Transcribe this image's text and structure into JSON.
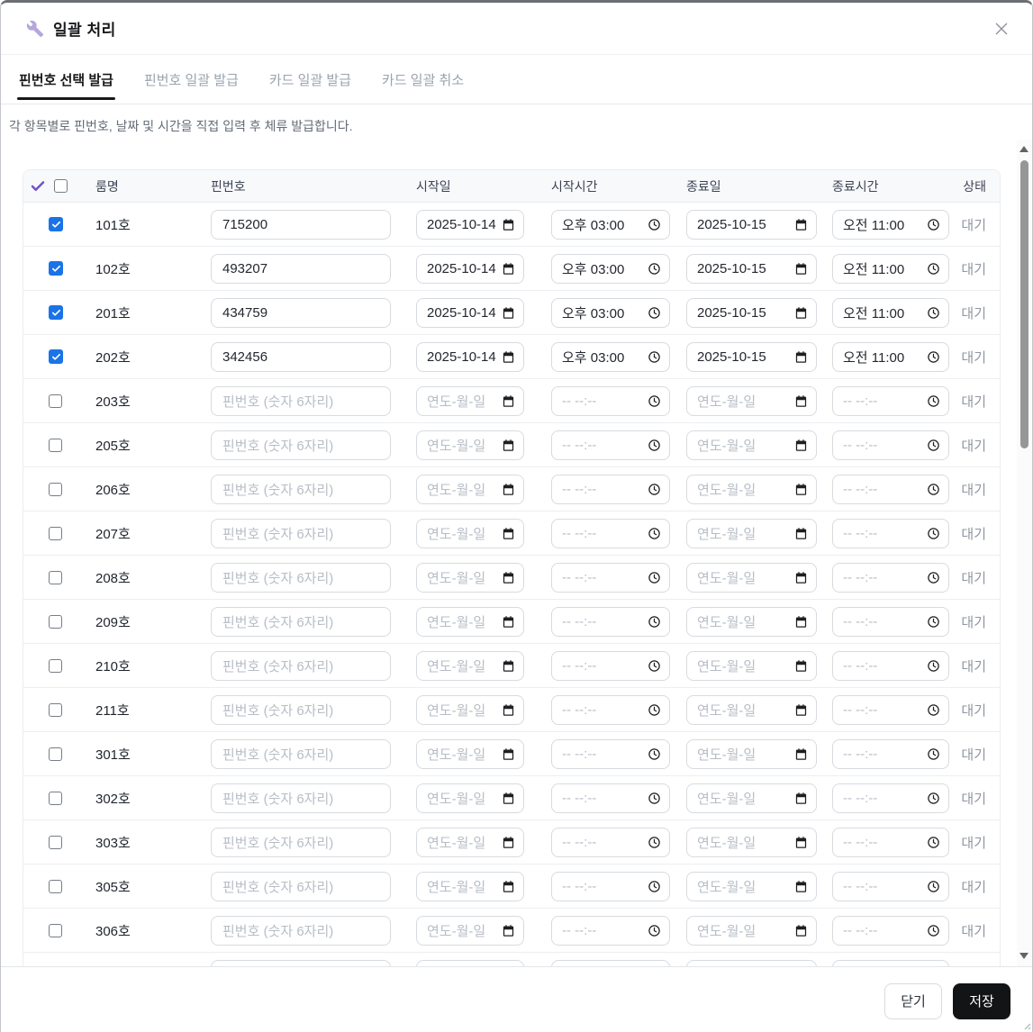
{
  "modal": {
    "title": "일괄 처리"
  },
  "tabs": [
    {
      "label": "핀번호 선택 발급",
      "active": true
    },
    {
      "label": "핀번호 일괄 발급",
      "active": false
    },
    {
      "label": "카드 일괄 발급",
      "active": false
    },
    {
      "label": "카드 일괄 취소",
      "active": false
    }
  ],
  "description": "각 항목별로 핀번호, 날짜 및 시간을 직접 입력 후 체류 발급합니다.",
  "table": {
    "columns": {
      "room": "룸명",
      "pin": "핀번호",
      "start_date": "시작일",
      "start_time": "시작시간",
      "end_date": "종료일",
      "end_time": "종료시간",
      "status": "상태"
    },
    "pin_placeholder": "핀번호 (숫자 6자리)",
    "date_placeholder": "연도-월-일",
    "time_placeholder": "-- --:--",
    "rows": [
      {
        "room": "101호",
        "checked": true,
        "pin": "715200",
        "start_date": "2025-10-14",
        "start_time": "오후 03:00",
        "end_date": "2025-10-15",
        "end_time": "오전 11:00",
        "status": "대기"
      },
      {
        "room": "102호",
        "checked": true,
        "pin": "493207",
        "start_date": "2025-10-14",
        "start_time": "오후 03:00",
        "end_date": "2025-10-15",
        "end_time": "오전 11:00",
        "status": "대기"
      },
      {
        "room": "201호",
        "checked": true,
        "pin": "434759",
        "start_date": "2025-10-14",
        "start_time": "오후 03:00",
        "end_date": "2025-10-15",
        "end_time": "오전 11:00",
        "status": "대기"
      },
      {
        "room": "202호",
        "checked": true,
        "pin": "342456",
        "start_date": "2025-10-14",
        "start_time": "오후 03:00",
        "end_date": "2025-10-15",
        "end_time": "오전 11:00",
        "status": "대기"
      },
      {
        "room": "203호",
        "checked": false,
        "pin": "",
        "start_date": "",
        "start_time": "",
        "end_date": "",
        "end_time": "",
        "status": "대기"
      },
      {
        "room": "205호",
        "checked": false,
        "pin": "",
        "start_date": "",
        "start_time": "",
        "end_date": "",
        "end_time": "",
        "status": "대기"
      },
      {
        "room": "206호",
        "checked": false,
        "pin": "",
        "start_date": "",
        "start_time": "",
        "end_date": "",
        "end_time": "",
        "status": "대기"
      },
      {
        "room": "207호",
        "checked": false,
        "pin": "",
        "start_date": "",
        "start_time": "",
        "end_date": "",
        "end_time": "",
        "status": "대기"
      },
      {
        "room": "208호",
        "checked": false,
        "pin": "",
        "start_date": "",
        "start_time": "",
        "end_date": "",
        "end_time": "",
        "status": "대기"
      },
      {
        "room": "209호",
        "checked": false,
        "pin": "",
        "start_date": "",
        "start_time": "",
        "end_date": "",
        "end_time": "",
        "status": "대기"
      },
      {
        "room": "210호",
        "checked": false,
        "pin": "",
        "start_date": "",
        "start_time": "",
        "end_date": "",
        "end_time": "",
        "status": "대기"
      },
      {
        "room": "211호",
        "checked": false,
        "pin": "",
        "start_date": "",
        "start_time": "",
        "end_date": "",
        "end_time": "",
        "status": "대기"
      },
      {
        "room": "301호",
        "checked": false,
        "pin": "",
        "start_date": "",
        "start_time": "",
        "end_date": "",
        "end_time": "",
        "status": "대기"
      },
      {
        "room": "302호",
        "checked": false,
        "pin": "",
        "start_date": "",
        "start_time": "",
        "end_date": "",
        "end_time": "",
        "status": "대기"
      },
      {
        "room": "303호",
        "checked": false,
        "pin": "",
        "start_date": "",
        "start_time": "",
        "end_date": "",
        "end_time": "",
        "status": "대기"
      },
      {
        "room": "305호",
        "checked": false,
        "pin": "",
        "start_date": "",
        "start_time": "",
        "end_date": "",
        "end_time": "",
        "status": "대기"
      },
      {
        "room": "306호",
        "checked": false,
        "pin": "",
        "start_date": "",
        "start_time": "",
        "end_date": "",
        "end_time": "",
        "status": "대기"
      }
    ]
  },
  "footer": {
    "close_label": "닫기",
    "save_label": "저장"
  },
  "colors": {
    "accent_purple": "#7452c8",
    "checkbox_blue": "#1a73e8",
    "save_button": "#131416",
    "status_gray": "#8f96a0",
    "tab_active": "#17181a"
  }
}
